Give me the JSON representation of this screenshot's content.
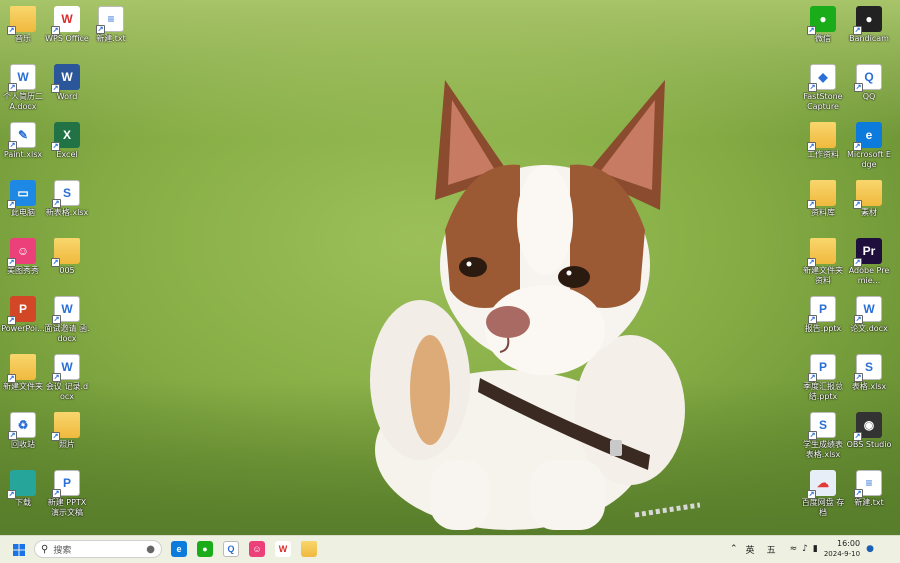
{
  "desktop": {
    "left_column_1": [
      {
        "label": "音乐",
        "icon": "music-folder-icon"
      },
      {
        "label": "个人简历二 A.docx",
        "icon": "wps-doc-icon"
      },
      {
        "label": "Paint.xlsx",
        "icon": "paint-file-icon"
      },
      {
        "label": "此电脑",
        "icon": "computer-icon"
      },
      {
        "label": "美图秀秀",
        "icon": "meitu-icon"
      },
      {
        "label": "PowerPoi...",
        "icon": "powerpoint-icon"
      },
      {
        "label": "新建文件夹",
        "icon": "folder-icon"
      },
      {
        "label": "回收站",
        "icon": "recycle-bin-icon"
      },
      {
        "label": "下载",
        "icon": "download-folder-icon"
      }
    ],
    "left_column_2": [
      {
        "label": "WPS Office",
        "icon": "wps-office-icon"
      },
      {
        "label": "Word",
        "icon": "word-icon"
      },
      {
        "label": "Excel",
        "icon": "excel-icon"
      },
      {
        "label": "新表格.xlsx",
        "icon": "wps-sheet-icon"
      },
      {
        "label": "005",
        "icon": "folder-icon"
      },
      {
        "label": "面试邀请 函.docx",
        "icon": "wps-doc-icon"
      },
      {
        "label": "会议 记录.docx",
        "icon": "wps-doc-icon"
      },
      {
        "label": "照片",
        "icon": "photo-folder-icon"
      },
      {
        "label": "新建 PPTX 演示文稿",
        "icon": "pptx-file-icon"
      }
    ],
    "left_column_3": [
      {
        "label": "新建.txt",
        "icon": "txt-file-icon"
      }
    ],
    "right_column_1": [
      {
        "label": "微信",
        "icon": "wechat-icon"
      },
      {
        "label": "FastStone Capture",
        "icon": "faststone-icon"
      },
      {
        "label": "工作资料",
        "icon": "folder-icon"
      },
      {
        "label": "资料库",
        "icon": "folder-icon"
      },
      {
        "label": "新建文件夹 资料",
        "icon": "folder-icon"
      },
      {
        "label": "报告.pptx",
        "icon": "pptx-file-icon"
      },
      {
        "label": "季度汇报总结.pptx",
        "icon": "pptx-file-icon"
      },
      {
        "label": "学生成绩表 表格.xlsx",
        "icon": "wps-sheet-icon"
      },
      {
        "label": "百度网盘 存档",
        "icon": "baidu-netdisk-icon"
      }
    ],
    "right_column_2": [
      {
        "label": "Bandicam",
        "icon": "bandicam-icon"
      },
      {
        "label": "QQ",
        "icon": "qq-icon"
      },
      {
        "label": "Microsoft Edge",
        "icon": "edge-icon"
      },
      {
        "label": "素材",
        "icon": "folder-icon"
      },
      {
        "label": "Adobe Premie...",
        "icon": "premiere-icon"
      },
      {
        "label": "论文.docx",
        "icon": "wps-doc-icon"
      },
      {
        "label": "表格.xlsx",
        "icon": "wps-sheet-icon"
      },
      {
        "label": "OBS Studio",
        "icon": "obs-icon"
      },
      {
        "label": "新建.txt",
        "icon": "txt-file-icon"
      }
    ]
  },
  "taskbar": {
    "search_placeholder": "搜索",
    "pinned": [
      "edge-icon",
      "wechat-icon",
      "qq-icon",
      "meitu-icon",
      "wps-office-icon",
      "file-explorer-icon"
    ],
    "tray": {
      "lang1": "英",
      "lang2": "五",
      "time": "16:00",
      "date": "2024-9-10"
    }
  },
  "colors": {
    "taskbar_bg": "#eef1e2",
    "grass": "#86ad45"
  }
}
